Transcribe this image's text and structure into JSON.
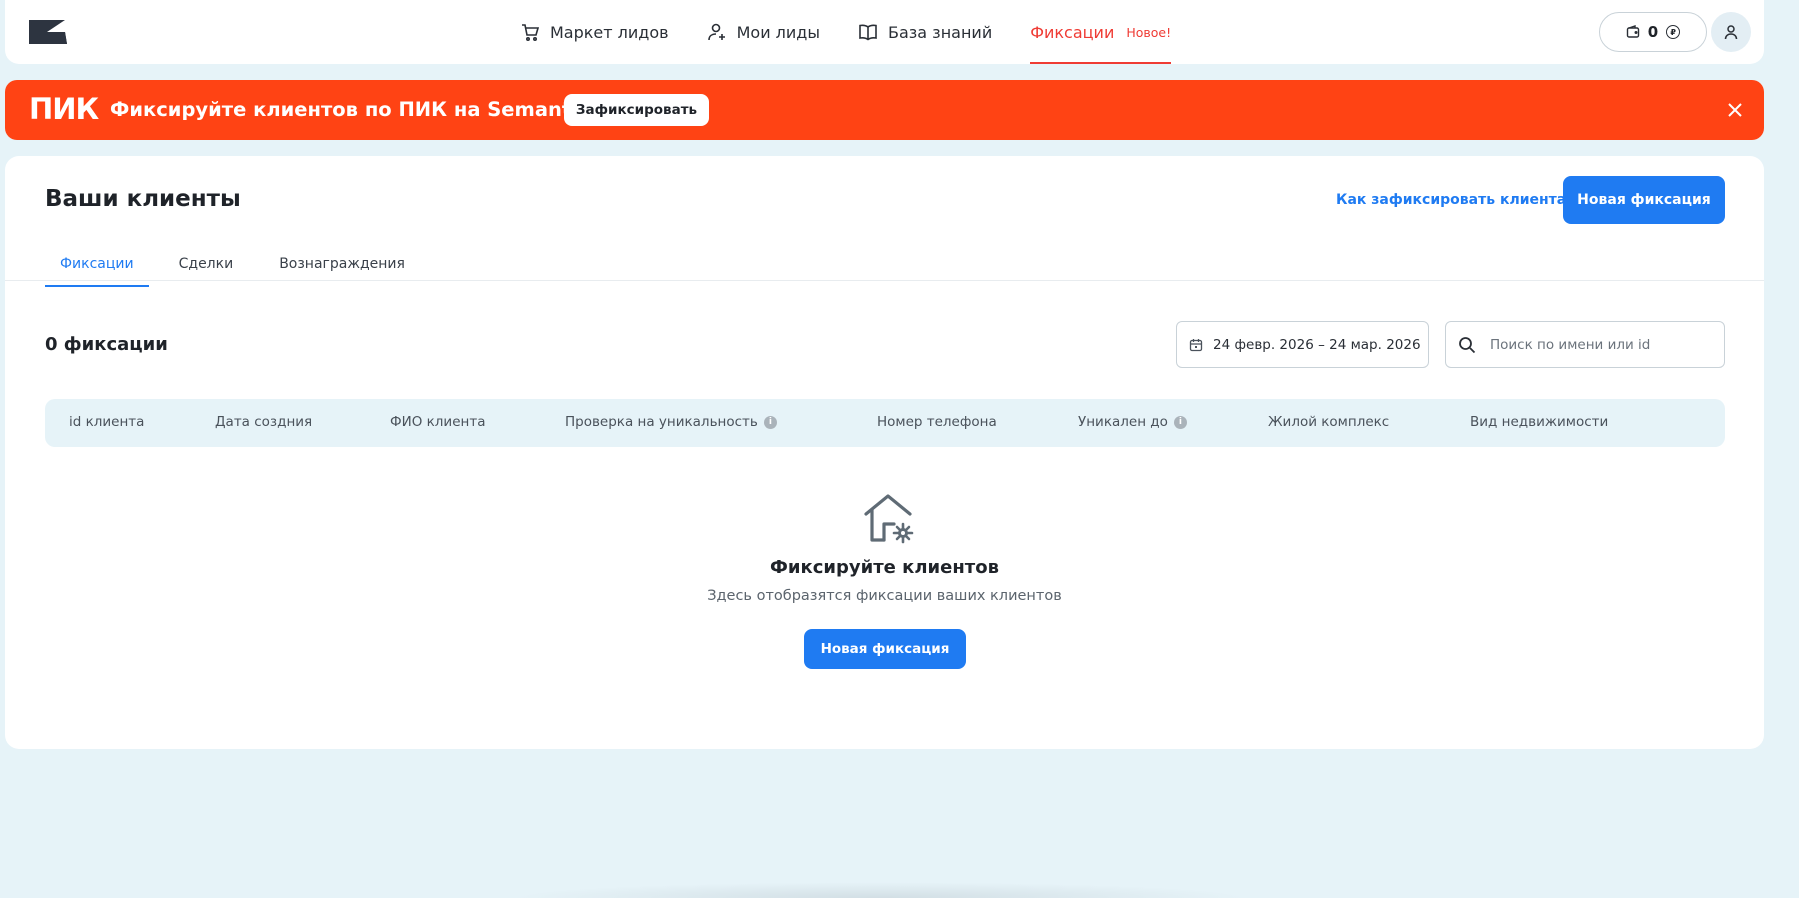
{
  "nav": {
    "items": [
      {
        "label": "Маркет лидов",
        "icon": "cart-icon"
      },
      {
        "label": "Мои лиды",
        "icon": "user-plus-icon"
      },
      {
        "label": "База знаний",
        "icon": "book-icon"
      },
      {
        "label": "Фиксации",
        "icon": ""
      }
    ],
    "badge": "Новое!",
    "balance": "0",
    "currency_symbol": "₽"
  },
  "banner": {
    "brand": "ПИК",
    "text": "Фиксируйте клиентов по ПИК на Semantiqo",
    "button": "Зафиксировать"
  },
  "page": {
    "title": "Ваши клиенты",
    "howto_link": "Как зафиксировать клиента?",
    "new_button": "Новая фиксация",
    "tabs": [
      "Фиксации",
      "Сделки",
      "Вознаграждения"
    ],
    "count": "0 фиксации",
    "date_range": "24 февр. 2026 – 24 мар. 2026",
    "search_placeholder": "Поиск по имени или id",
    "columns": [
      "id клиента",
      "Дата создния",
      "ФИО клиента",
      "Проверка на уникальность",
      "Номер телефона",
      "Уникален до",
      "Жилой комплекс",
      "Вид недвижимости"
    ]
  },
  "empty": {
    "title": "Фиксируйте клиентов",
    "subtitle": "Здесь отобразятся фиксации ваших клиентов",
    "button": "Новая фиксация"
  },
  "colors": {
    "accent": "#1f7bf2",
    "banner": "#ff4314",
    "active_nav": "#ef3b34",
    "background": "#e6f3f8"
  }
}
